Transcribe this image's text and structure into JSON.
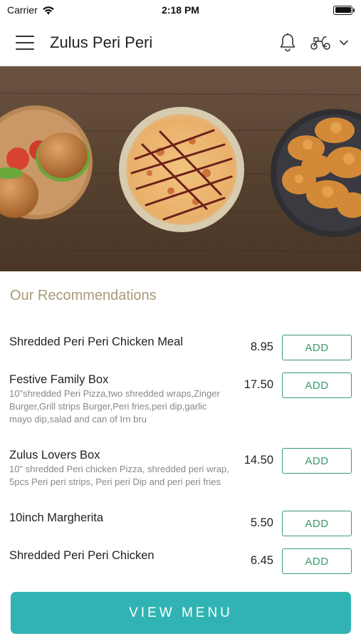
{
  "status_bar": {
    "carrier": "Carrier",
    "time": "2:18 PM"
  },
  "app_bar": {
    "title": "Zulus Peri Peri",
    "icons": [
      "menu-icon",
      "bell-icon",
      "scooter-icon",
      "chevron-down-icon"
    ]
  },
  "hero": {
    "image": "food-banner",
    "colors": {
      "wood": "#5a4434",
      "pizza": "#e7b877",
      "chicken": "#d9913f"
    }
  },
  "recommendations": {
    "title": "Our Recommendations",
    "items": [
      {
        "name": "Shredded Peri Peri Chicken Meal",
        "description": "",
        "price": "8.95",
        "button": "ADD"
      },
      {
        "name": "Festive Family Box",
        "description": "10\"shredded Peri Pizza,two shredded wraps,Zinger Burger,Grill strips Burger,Peri fries,peri dip,garlic mayo dip,salad and can of Irn bru",
        "price": "17.50",
        "button": "ADD"
      },
      {
        "name": "Zulus Lovers Box",
        "description": "10\" shredded Peri chicken Pizza, shredded peri wrap, 5pcs Peri peri strips, Peri peri Dip and peri peri fries",
        "price": "14.50",
        "button": "ADD"
      },
      {
        "name": "10inch Margherita",
        "description": "",
        "price": "5.50",
        "button": "ADD"
      },
      {
        "name": "Shredded Peri Peri Chicken",
        "description": "",
        "price": "6.45",
        "button": "ADD"
      }
    ]
  },
  "footer": {
    "view_menu_label": "VIEW MENU"
  },
  "colors": {
    "accent": "#31b3b3",
    "add_button": "#3a9a6a",
    "section_title": "#a99a78"
  }
}
